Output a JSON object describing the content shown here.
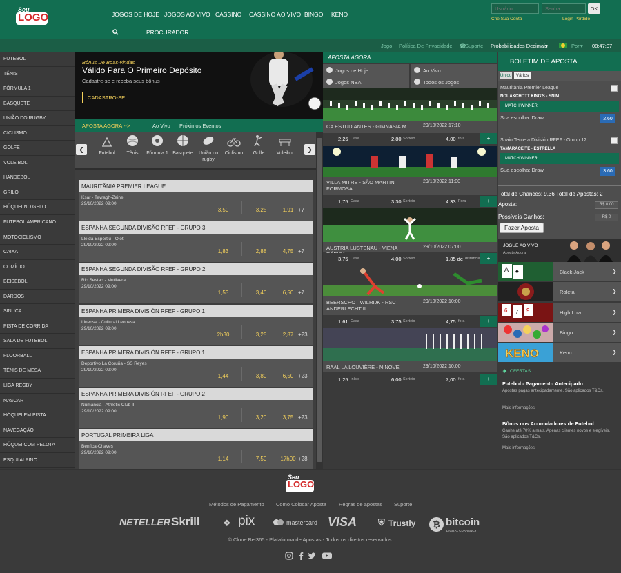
{
  "logo": {
    "seu": "Seu",
    "word": "LOGO"
  },
  "nav": {
    "links": [
      "JOGOS DE HOJE",
      "JOGOS AO VIVO",
      "CASSINO",
      "CASSINO AO VIVO",
      "BINGO",
      "KENO"
    ],
    "procurador": "PROCURADOR"
  },
  "login": {
    "user_placeholder": "Usuário",
    "pass_placeholder": "Senha",
    "ok": "OK",
    "register": "Crie Sua Conta",
    "lost": "Login Perdido"
  },
  "subbar": {
    "jogo": "Jogo",
    "privacy": "Política De Privacidade",
    "support": "Suporte",
    "odds_format": "Probabilidades Decimais",
    "lang": "Por",
    "time": "08:47:07"
  },
  "sidebar": [
    "FUTEBOL",
    "TÊNIS",
    "FÓRMULA 1",
    "BASQUETE",
    "UNIÃO DO RUGBY",
    "CICLISMO",
    "GOLFE",
    "VOLEIBOL",
    "HANDEBOL",
    "GRILO",
    "HÓQUEI NO GELO",
    "FUTEBOL AMERICANO",
    "MOTOCICLISMO",
    "CAIXA",
    "COMÍCIO",
    "BEISEBOL",
    "DARDOS",
    "SINUCA",
    "PISTA DE CORRIDA",
    "SALA DE FUTEBOL",
    "FLOORBALL",
    "TÊNIS DE MESA",
    "LIGA REGBY",
    "NASCAR",
    "HÓQUEI EM PISTA",
    "NAVEGAÇÃO",
    "HÓQUEI COM PELOTA",
    "ESQUI ALPINO"
  ],
  "banner": {
    "line1": "Bônus De Boas-vindas",
    "line2": "Válido Para O Primeiro Depósito",
    "line3": "Cadastre-se e receba seus bônus",
    "button": "CADASTRO-SE"
  },
  "centerbar": {
    "aposta": "APOSTA AGORA -->",
    "aovivo": "Ao Vivo",
    "proximos": "Próximos Eventos"
  },
  "sports": [
    "Futebol",
    "Tênis",
    "Fórmula 1",
    "Basquete",
    "União do rugby",
    "Ciclismo",
    "Golfe",
    "Voleibol"
  ],
  "leagues": [
    {
      "name": "MAURITÂNIA PREMIER LEAGUE",
      "teams": "Ksar - Tevragh-Zeine",
      "date": "29/10/2022 09:00",
      "odds": [
        "3,50",
        "3,25",
        "1,91"
      ],
      "more": "+7"
    },
    {
      "name": "ESPANHA SEGUNDA DIVISÃO RFEF - GRUPO 3",
      "teams": "Lleida Esportiu - Olot",
      "date": "29/10/2022 09:00",
      "odds": [
        "1,83",
        "2,88",
        "4,75"
      ],
      "more": "+7"
    },
    {
      "name": "ESPANHA SEGUNDA DIVISÃO RFEF - GRUPO 2",
      "teams": "Rio Sestao - Mutilvera",
      "date": "29/10/2022 09:00",
      "odds": [
        "1,53",
        "3,40",
        "6,50"
      ],
      "more": "+7"
    },
    {
      "name": "ESPANHA PRIMERA DIVISIÓN RFEF - GRUPO 1",
      "teams": "Linense - Cultural Leonesa",
      "date": "29/10/2022 09:00",
      "odds": [
        "2h30",
        "3,25",
        "2,87"
      ],
      "more": "+23"
    },
    {
      "name": "ESPANHA PRIMERA DIVISIÓN RFEF - GRUPO 1",
      "teams": "Deportivo La Coruña - SS Reyes",
      "date": "29/10/2022 09:00",
      "odds": [
        "1,44",
        "3,80",
        "6,50"
      ],
      "more": "+23"
    },
    {
      "name": "ESPANHA PRIMERA DIVISIÓN RFEF - GRUPO 2",
      "teams": "Numancia - Athletic Club II",
      "date": "29/10/2022 09:00",
      "odds": [
        "1,90",
        "3,20",
        "3,75"
      ],
      "more": "+23"
    },
    {
      "name": "PORTUGAL PRIMEIRA LIGA",
      "teams": "Benfica-Chaves",
      "date": "29/10/2022 09:00",
      "odds": [
        "1,14",
        "7,50",
        "17h00"
      ],
      "more": "+28"
    }
  ],
  "live": {
    "header": "APOSTA AGORA",
    "tabs": [
      "Jogos de Hoje",
      "Ao Vivo",
      "Jogos NBA",
      "Todos os Jogos"
    ],
    "events": [
      {
        "title": "CA ESTUDIANTES - GIMNASIA M.",
        "date": "29/10/2022 17:10",
        "o1": "2.25",
        "l1": "Casa",
        "o2": "2.80",
        "l2": "Sorteio",
        "o3": "4,00",
        "l3": "fora"
      },
      {
        "title": "VILLA MITRE - SÃO MARTIN FORMOSA",
        "date": "29/10/2022 11:00",
        "o1": "1,75",
        "l1": "Casa",
        "o2": "3.30",
        "l2": "Sorteio",
        "o3": "4.33",
        "l3": "Fora"
      },
      {
        "title": "ÁUSTRIA LUSTENAU - VIENA RÁPIDA",
        "date": "29/10/2022 07:00",
        "o1": "3,75",
        "l1": "Casa",
        "o2": "4,00",
        "l2": "Sorteio",
        "o3": "1,85 de",
        "l3": "distância"
      },
      {
        "title": "BEERSCHOT WILRIJK - RSC ANDERLECHT II",
        "date": "29/10/2022 10:00",
        "o1": "1.61",
        "l1": "Casa",
        "o2": "3.75",
        "l2": "Sorteio",
        "o3": "4,75",
        "l3": "fora"
      },
      {
        "title": "RAAL LA LOUVIÈRE - NINOVE",
        "date": "29/10/2022 10:00",
        "o1": "1.25",
        "l1": "Início",
        "o2": "6,00",
        "l2": "Sorteio",
        "o3": "7,00",
        "l3": "fora"
      }
    ]
  },
  "betslip": {
    "title": "BOLETIM DE APOSTA",
    "tab_single": "Único",
    "tab_multi": "Vários",
    "selections": [
      {
        "league": "Mauritânia Premier League",
        "match": "NOUAKCHOTT KING'S - SNIM",
        "market": "MATCH WINNER",
        "choice": "Sua escolha: Draw",
        "odd": "2.60"
      },
      {
        "league": "Spain Tercera División RFEF - Group 12",
        "match": "TAMARACEITE - ESTRELLA",
        "market": "MATCH WINNER",
        "choice": "Sua escolha: Draw",
        "odd": "3.60"
      }
    ],
    "totals": "Total de Chances: 9.36 Total de Apostas: 2",
    "stake_label": "Aposta:",
    "stake_value": "R$ 0.00",
    "win_label": "Possíveis Ganhos:",
    "win_value": "R$ 0",
    "place": "Fazer Aposta"
  },
  "casino": {
    "head1": "JOGUE AO VIVO",
    "head2": "Aposte Agora",
    "games": [
      "Black Jack",
      "Roleta",
      "High Low",
      "Bingo",
      "Keno"
    ],
    "keno_word": "KENO"
  },
  "offers": {
    "title": "OFERTAS",
    "items": [
      {
        "title": "Futebol - Pagamento Antecipado",
        "desc": "Apostas pagas antecipadamente. São aplicados T&Cs.",
        "more": "Mais informações"
      },
      {
        "title": "Bônus nos Acumuladores de Futebol",
        "desc": "Ganhe até 70% a mais. Apenas clientes novos e elegíveis. São aplicados T&Cs.",
        "more": "Mais informações"
      }
    ]
  },
  "footer": {
    "links": [
      "Métodos de Pagamento",
      "Como Colocar Aposta",
      "Regras de apostas",
      "Suporte"
    ],
    "payments": [
      "NETELLER",
      "Skrill",
      "pix",
      "mastercard",
      "VISA",
      "Trustly",
      "bitcoin"
    ],
    "bitcoin_sub": "DIGITAL CURRENCY",
    "copyright": "© Clone Bet365 - Plataforma de Apostas - Todos os direitos reservados."
  },
  "colors": {
    "brand_green": "#126e51",
    "odds_yellow": "#f4d15b",
    "odd_blue": "#2a6bb5"
  }
}
